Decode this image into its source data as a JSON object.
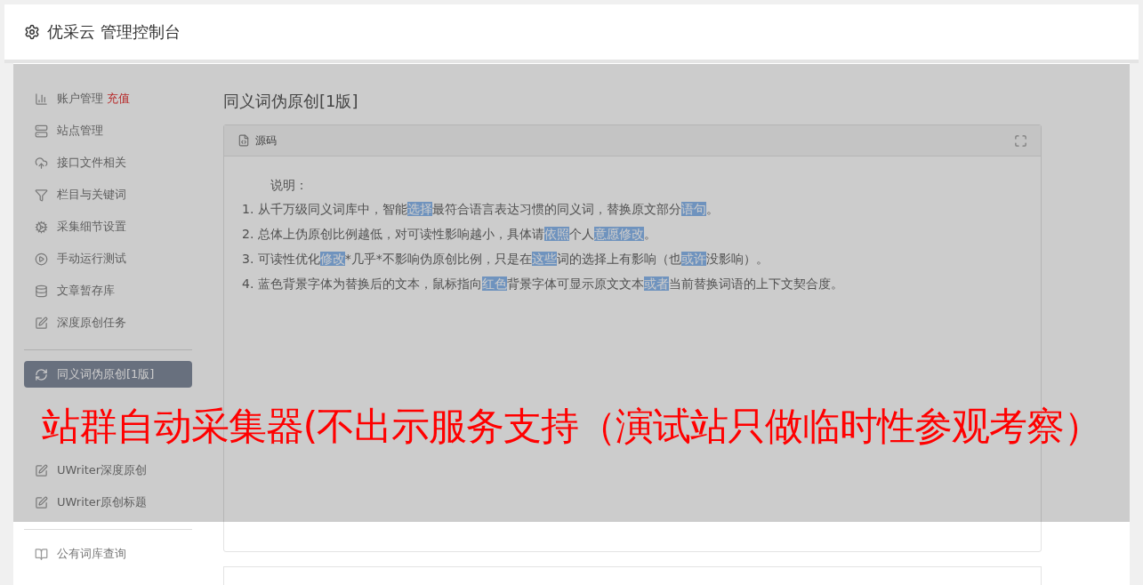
{
  "header": {
    "title": "优采云 管理控制台"
  },
  "sidebar": {
    "groups": [
      {
        "items": [
          {
            "label": "账户管理",
            "badge": "充值",
            "selected": false
          },
          {
            "label": "站点管理",
            "selected": false
          },
          {
            "label": "接口文件相关",
            "selected": false
          },
          {
            "label": "栏目与关键词",
            "selected": false
          },
          {
            "label": "采集细节设置",
            "selected": false
          },
          {
            "label": "手动运行测试",
            "selected": false
          },
          {
            "label": "文章暂存库",
            "selected": false
          },
          {
            "label": "深度原创任务",
            "selected": false
          }
        ]
      },
      {
        "items": [
          {
            "label": "同义词伪原创[1版]",
            "selected": true
          },
          {
            "label": "UWriter深度原创",
            "selected": false
          },
          {
            "label": "UWriter原创标题",
            "selected": false
          }
        ]
      },
      {
        "items": [
          {
            "label": "公有词库查询",
            "selected": false
          }
        ]
      }
    ]
  },
  "content": {
    "page_title": "同义词伪原创[1版]",
    "panel": {
      "title": "源码",
      "intro": "说明：",
      "lines": [
        [
          {
            "text": "1. 从千万级同义词库中，智能",
            "highlighted": false
          },
          {
            "text": "选择",
            "highlighted": true
          },
          {
            "text": "最符合语言表达习惯的同义词，替换原文部分",
            "highlighted": false
          },
          {
            "text": "语句",
            "highlighted": true
          },
          {
            "text": "。",
            "highlighted": false
          }
        ],
        [
          {
            "text": "2. 总体上伪原创比例越低，对可读性影响越小，具体请",
            "highlighted": false
          },
          {
            "text": "依照",
            "highlighted": true
          },
          {
            "text": "个人",
            "highlighted": false
          },
          {
            "text": "意愿",
            "highlighted": true
          },
          {
            "text": "修改",
            "highlighted": true
          },
          {
            "text": "。",
            "highlighted": false
          }
        ],
        [
          {
            "text": "3. 可读性优化",
            "highlighted": false
          },
          {
            "text": "修改",
            "highlighted": true
          },
          {
            "text": "*几乎*不影响伪原创比例，只是在",
            "highlighted": false
          },
          {
            "text": "这些",
            "highlighted": true
          },
          {
            "text": "词的选择上有影响（也",
            "highlighted": false
          },
          {
            "text": "或许",
            "highlighted": true
          },
          {
            "text": "没影响）。",
            "highlighted": false
          }
        ],
        [
          {
            "text": "4. 蓝色背景字体为替换后的文本，鼠标指向",
            "highlighted": false
          },
          {
            "text": "红色",
            "highlighted": true
          },
          {
            "text": "背景字体可显示原文文本",
            "highlighted": false
          },
          {
            "text": "或者",
            "highlighted": true
          },
          {
            "text": "当前替换词语的上下文契合度。",
            "highlighted": false
          }
        ]
      ]
    }
  },
  "overlay": {
    "notice": "站群自动采集器(不出示服务支持（演试站只做临时性参观考察）"
  }
}
